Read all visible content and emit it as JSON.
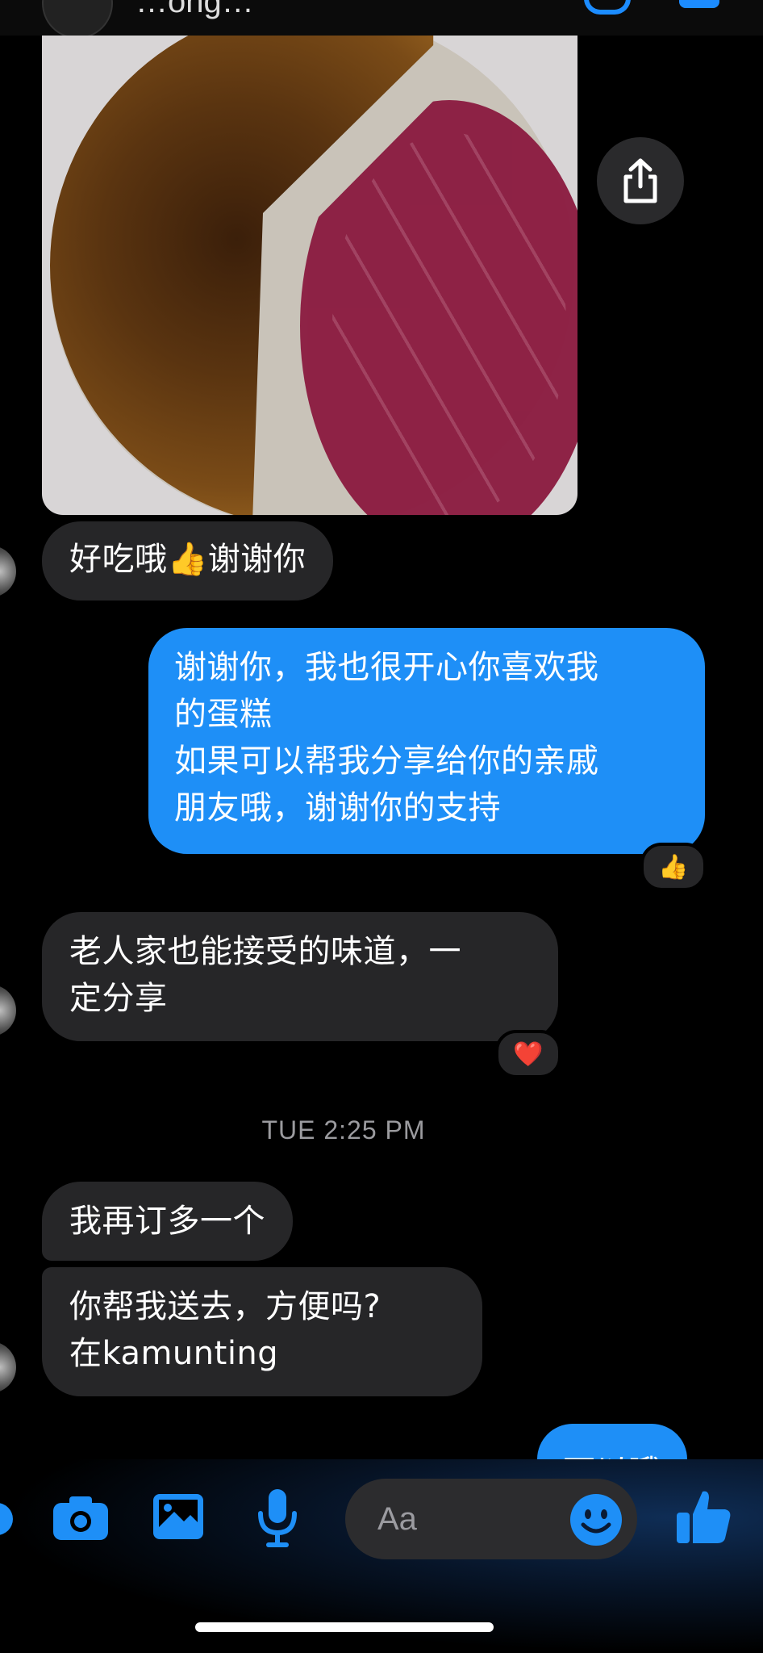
{
  "header": {
    "contact_name": "…ong…"
  },
  "thread": {
    "photo_alt": "Basque burnt cheesecake on red board",
    "msg1": "好吃哦👍谢谢你",
    "msg2": "谢谢你，我也很开心你喜欢我\n的蛋糕\n如果可以帮我分享给你的亲戚\n朋友哦，谢谢你的支持",
    "msg2_reaction": "👍",
    "msg3": "老人家也能接受的味道，一\n定分享",
    "msg3_reaction": "❤️",
    "timestamp": "TUE 2:25 PM",
    "msg4": "我再订多一个",
    "msg5": "你帮我送去，方便吗?\n在kamunting",
    "msg6_partial": "可以哦"
  },
  "composer": {
    "placeholder": "Aa",
    "icons": [
      "apps-icon",
      "camera-icon",
      "gallery-icon",
      "microphone-icon",
      "emoji-icon",
      "like-icon"
    ]
  },
  "colors": {
    "accent": "#1e8ff7",
    "bubble_in": "#262628",
    "background": "#000000"
  }
}
